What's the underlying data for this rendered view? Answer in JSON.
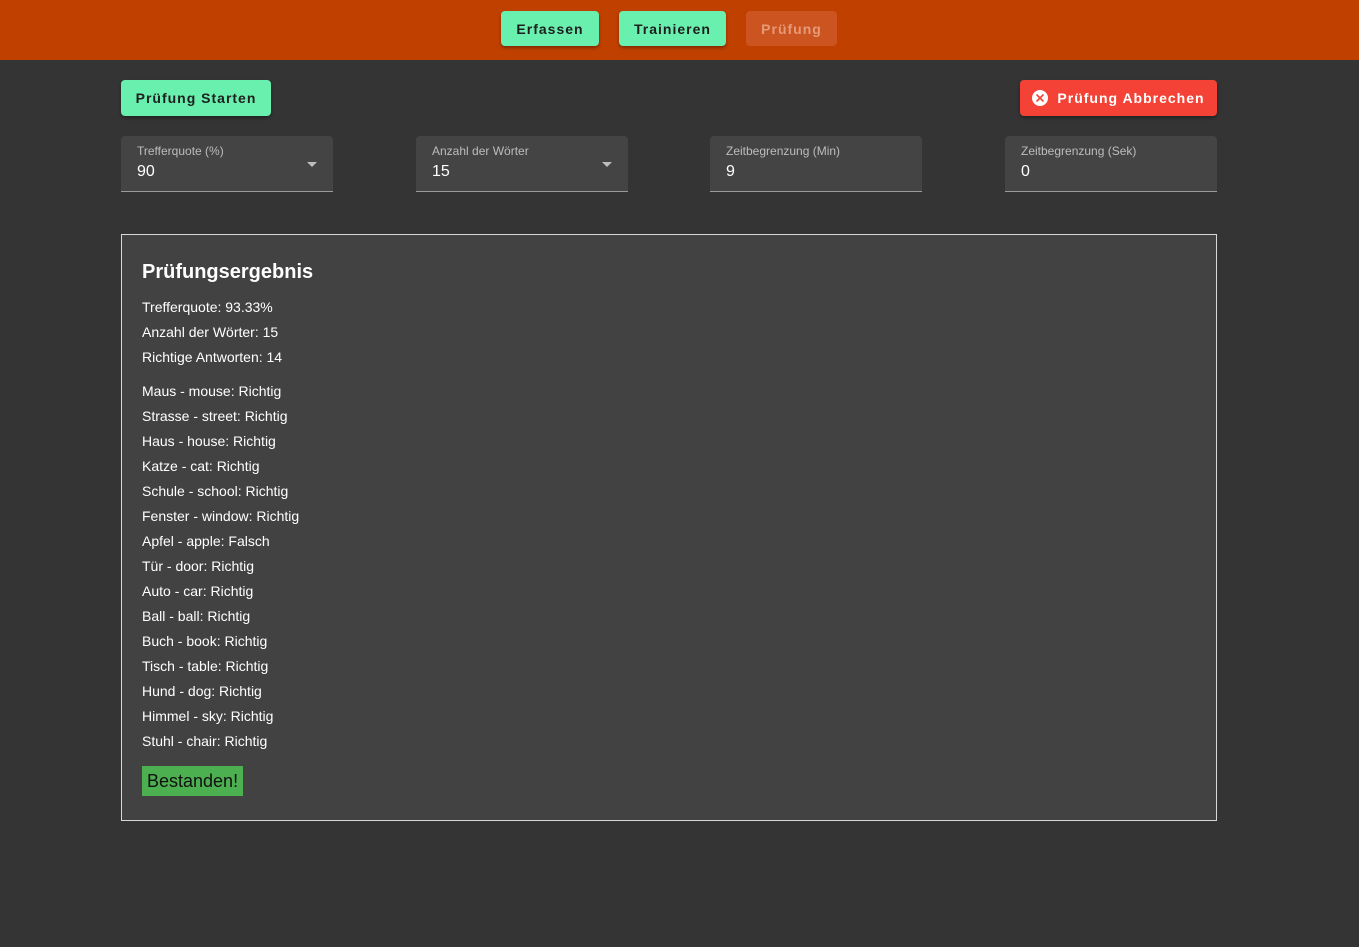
{
  "nav": {
    "erfassen": "Erfassen",
    "trainieren": "Trainieren",
    "pruefung": "Prüfung"
  },
  "actions": {
    "start": "Prüfung Starten",
    "abort": "Prüfung Abbrechen"
  },
  "fields": {
    "trefferquote": {
      "label": "Trefferquote (%)",
      "value": "90"
    },
    "anzahl": {
      "label": "Anzahl der Wörter",
      "value": "15"
    },
    "zeit_min": {
      "label": "Zeitbegrenzung (Min)",
      "value": "9"
    },
    "zeit_sek": {
      "label": "Zeitbegrenzung (Sek)",
      "value": "0"
    }
  },
  "result": {
    "title": "Prüfungsergebnis",
    "trefferquote": "Trefferquote: 93.33%",
    "anzahl": "Anzahl der Wörter: 15",
    "richtige": "Richtige Antworten: 14",
    "words": [
      "Maus - mouse: Richtig",
      "Strasse - street: Richtig",
      "Haus - house: Richtig",
      "Katze - cat: Richtig",
      "Schule - school: Richtig",
      "Fenster - window: Richtig",
      "Apfel - apple: Falsch",
      "Tür - door: Richtig",
      "Auto - car: Richtig",
      "Ball - ball: Richtig",
      "Buch - book: Richtig",
      "Tisch - table: Richtig",
      "Hund - dog: Richtig",
      "Himmel - sky: Richtig",
      "Stuhl - chair: Richtig"
    ],
    "status": "Bestanden!"
  },
  "colors": {
    "topbar": "#c04000",
    "accent_green": "#69f0ae",
    "danger_red": "#f44336",
    "passed_green": "#4caf50",
    "background": "#343434"
  },
  "icons": {
    "abort": "close-circle-icon",
    "select": "dropdown-caret-icon"
  }
}
